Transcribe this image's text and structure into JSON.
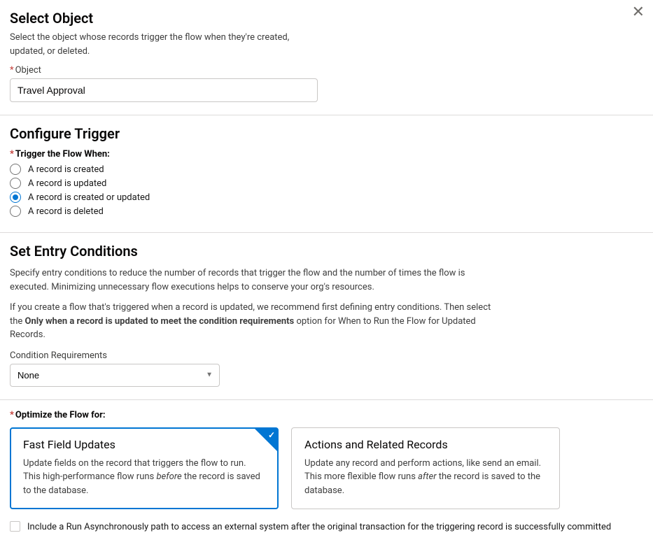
{
  "close": "✕",
  "selectObject": {
    "title": "Select Object",
    "desc": "Select the object whose records trigger the flow when they're created, updated, or deleted.",
    "label": "Object",
    "value": "Travel Approval"
  },
  "configureTrigger": {
    "title": "Configure Trigger",
    "label": "Trigger the Flow When:",
    "options": [
      {
        "label": "A record is created",
        "checked": false
      },
      {
        "label": "A record is updated",
        "checked": false
      },
      {
        "label": "A record is created or updated",
        "checked": true
      },
      {
        "label": "A record is deleted",
        "checked": false
      }
    ]
  },
  "entryConditions": {
    "title": "Set Entry Conditions",
    "desc1": "Specify entry conditions to reduce the number of records that trigger the flow and the number of times the flow is executed. Minimizing unnecessary flow executions helps to conserve your org's resources.",
    "desc2_pre": "If you create a flow that's triggered when a record is updated, we recommend first defining entry conditions. Then select the ",
    "desc2_bold": "Only when a record is updated to meet the condition requirements",
    "desc2_post": " option for When to Run the Flow for Updated Records.",
    "selectLabel": "Condition Requirements",
    "selectValue": "None"
  },
  "optimize": {
    "label": "Optimize the Flow for:",
    "cards": [
      {
        "title": "Fast Field Updates",
        "body_pre": "Update fields on the record that triggers the flow to run. This high-performance flow runs ",
        "body_italic": "before",
        "body_post": " the record is saved to the database.",
        "selected": true
      },
      {
        "title": "Actions and Related Records",
        "body_pre": "Update any record and perform actions, like send an email. This more flexible flow runs ",
        "body_italic": "after",
        "body_post": " the record is saved to the database.",
        "selected": false
      }
    ],
    "asyncLabel": "Include a Run Asynchronously path to access an external system after the original transaction for the triggering record is successfully committed"
  }
}
